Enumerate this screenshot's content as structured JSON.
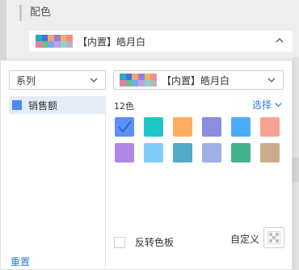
{
  "section": {
    "title": "配色"
  },
  "scheme_select": {
    "label": "【内置】皓月白",
    "expanded": true
  },
  "series_select": {
    "label": "系列"
  },
  "series_list": [
    {
      "name": "销售额",
      "color": "#4a8af4",
      "selected": true
    }
  ],
  "palette": {
    "count_label": "12色",
    "choose_label": "选择",
    "colors": [
      "#5b8ff9",
      "#1ec5c5",
      "#fdae61",
      "#8c8ce0",
      "#4cadf7",
      "#f8a293",
      "#b086e6",
      "#80cdf7",
      "#52a9c8",
      "#9fb0e4",
      "#43b28a",
      "#c9ad8b"
    ],
    "selected_index": 0
  },
  "mosaic_colors": [
    "#2aa8c4",
    "#4a6ee0",
    "#f0a868",
    "#9a7be0",
    "#e7b85a",
    "#f28b8b",
    "#e57fa0",
    "#6cc27b",
    "#76a9f0",
    "#c2a0e0",
    "#8ed3d3",
    "#b7b7b7"
  ],
  "reverse": {
    "label": "反转色板",
    "checked": false
  },
  "custom": {
    "label": "自定义"
  },
  "footer": {
    "reset_label": "重置"
  },
  "icons": {
    "chevron_up": "chevron-up-icon",
    "chevron_down": "chevron-down-icon",
    "check": "check-icon",
    "custom": "transparent-color-icon"
  }
}
